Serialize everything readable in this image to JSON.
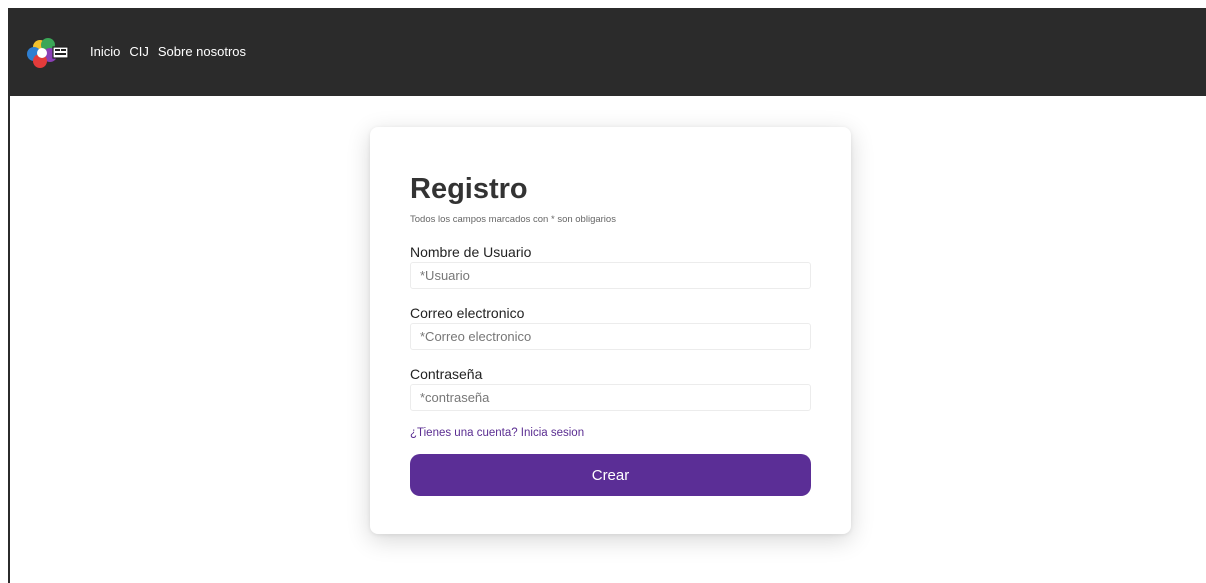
{
  "nav": {
    "links": [
      "Inicio",
      "CIJ",
      "Sobre nosotros"
    ],
    "background": "#2b2b2b"
  },
  "form": {
    "title": "Registro",
    "subtitle": "Todos los campos marcados con * son obligarios",
    "username": {
      "label": "Nombre de Usuario",
      "placeholder": "*Usuario",
      "value": ""
    },
    "email": {
      "label": "Correo electronico",
      "placeholder": "*Correo electronico",
      "value": ""
    },
    "password": {
      "label": "Contraseña",
      "placeholder": "*contraseña",
      "value": ""
    },
    "login_link": "¿Tienes una cuenta? Inicia sesion",
    "submit_label": "Crear"
  },
  "colors": {
    "accent": "#5b2e96",
    "link": "#5a2d91"
  },
  "icons": {
    "logo": "colorful-flower-logo-icon"
  }
}
